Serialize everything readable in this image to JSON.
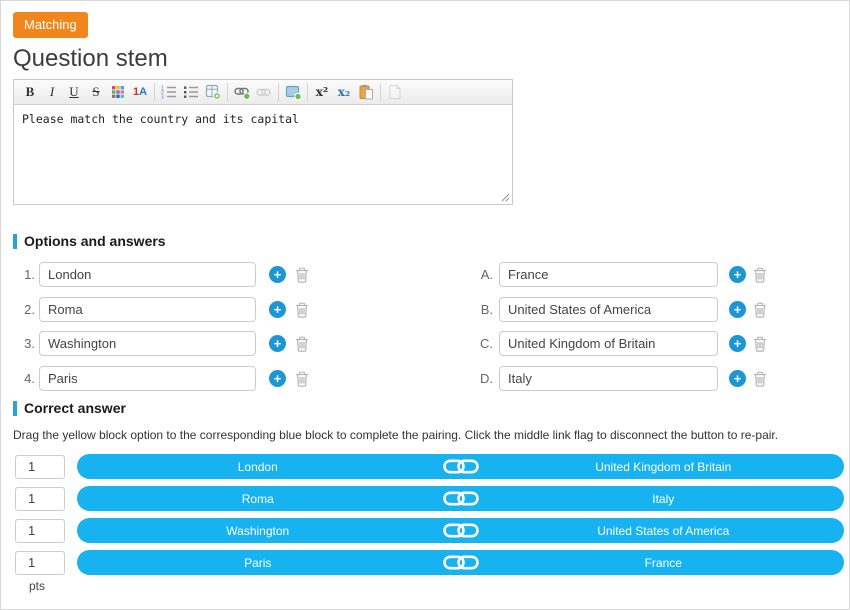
{
  "badge": {
    "label": "Matching"
  },
  "question_stem": {
    "title": "Question stem",
    "text": "Please match the country and its capital"
  },
  "toolbar": {
    "bold_label": "B",
    "italic_label": "I",
    "underline_label": "U",
    "strikethrough_label": "S",
    "fontsize_digit": "1",
    "fontsize_letter": "A",
    "superscript_label": "x²",
    "subscript_label": "x₂"
  },
  "options_section": {
    "title": "Options and answers",
    "left_options": [
      {
        "label": "1.",
        "value": "London"
      },
      {
        "label": "2.",
        "value": "Roma"
      },
      {
        "label": "3.",
        "value": "Washington"
      },
      {
        "label": "4.",
        "value": "Paris"
      }
    ],
    "right_options": [
      {
        "label": "A.",
        "value": "France"
      },
      {
        "label": "B.",
        "value": "United States of America"
      },
      {
        "label": "C.",
        "value": "United Kingdom of Britain"
      },
      {
        "label": "D.",
        "value": "Italy"
      }
    ]
  },
  "correct_answer": {
    "title": "Correct answer",
    "instruction": "Drag the yellow block option to the corresponding blue block to complete the pairing. Click the middle link flag to disconnect the button to re-pair.",
    "pairs": [
      {
        "points": "1",
        "left": "London",
        "right": "United Kingdom of Britain"
      },
      {
        "points": "1",
        "left": "Roma",
        "right": "Italy"
      },
      {
        "points": "1",
        "left": "Washington",
        "right": "United States of America"
      },
      {
        "points": "1",
        "left": "Paris",
        "right": "France"
      }
    ],
    "points_label": "pts"
  },
  "colors": {
    "badge_orange": "#f0861c",
    "pill_cyan": "#17b2f0",
    "add_button_blue": "#1d96d6",
    "section_bar_blue": "#25a3dd"
  }
}
